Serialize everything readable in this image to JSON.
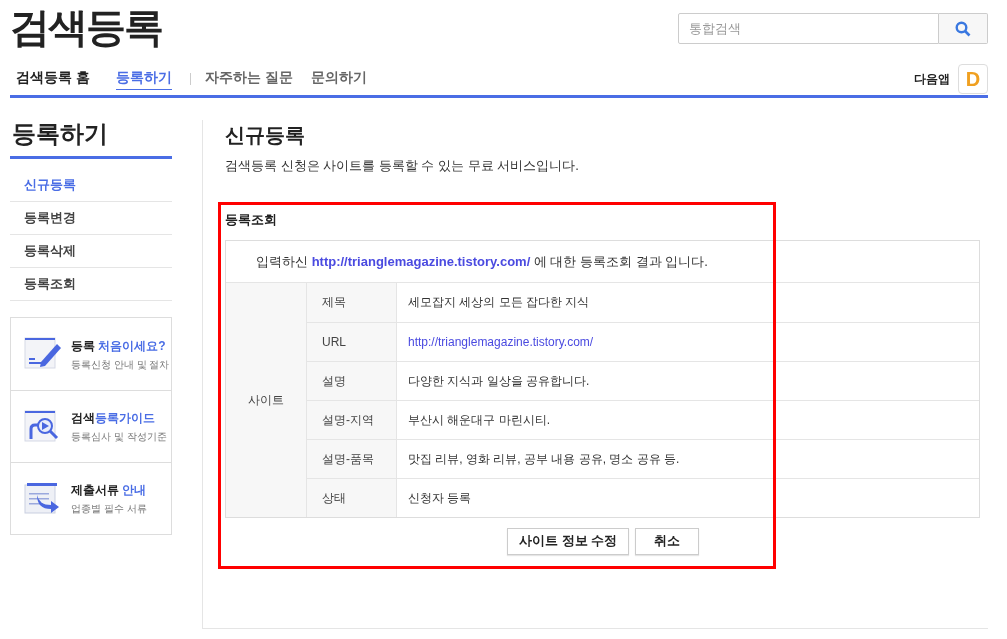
{
  "header": {
    "logo": "검색등록",
    "search": {
      "placeholder": "통합검색"
    },
    "app_label": "다음앱",
    "app_icon_letter": "D"
  },
  "nav": [
    {
      "label": "검색등록 홈",
      "kind": "home",
      "selected": false
    },
    {
      "label": "등록하기",
      "kind": "link",
      "selected": true
    },
    {
      "label": "자주하는 질문",
      "kind": "link",
      "selected": false
    },
    {
      "label": "문의하기",
      "kind": "link",
      "selected": false
    }
  ],
  "sidebar": {
    "title": "등록하기",
    "items": [
      {
        "label": "신규등록",
        "selected": true
      },
      {
        "label": "등록변경",
        "selected": false
      },
      {
        "label": "등록삭제",
        "selected": false
      },
      {
        "label": "등록조회",
        "selected": false
      }
    ],
    "promos": [
      {
        "kind": "pencil",
        "title": "등록 ",
        "title_highlight": "처음이세요?",
        "subtitle": "등록신청 안내 및 절차"
      },
      {
        "kind": "magnifier",
        "title": "검색",
        "title_highlight": "등록가이드",
        "subtitle": "등록심사 및 작성기준"
      },
      {
        "kind": "documents",
        "title": "제출서류 ",
        "title_highlight": "안내",
        "subtitle": "업종별 필수 서류"
      }
    ]
  },
  "main": {
    "title": "신규등록",
    "description": "검색등록 신청은 사이트를 등록할 수 있는 무료 서비스입니다.",
    "lookup": {
      "title": "등록조회",
      "intro_before": "입력하신 ",
      "intro_link": "http://trianglemagazine.tistory.com/",
      "intro_after": " 에 대한 등록조회 결과 입니다.",
      "group_label": "사이트",
      "rows": [
        {
          "label": "제목",
          "value": "세모잡지 세상의 모든 잡다한 지식",
          "kind": "text"
        },
        {
          "label": "URL",
          "value": "http://trianglemagazine.tistory.com/",
          "kind": "link"
        },
        {
          "label": "설명",
          "value": "다양한 지식과 일상을 공유합니다.",
          "kind": "text"
        },
        {
          "label": "설명-지역",
          "value": "부산시 해운대구 마린시티.",
          "kind": "text"
        },
        {
          "label": "설명-품목",
          "value": "맛집 리뷰, 영화 리뷰, 공부 내용 공유, 명소 공유 등.",
          "kind": "text"
        },
        {
          "label": "상태",
          "value": "신청자 등록",
          "kind": "text"
        }
      ],
      "buttons": [
        "사이트 정보 수정",
        "취소"
      ]
    }
  }
}
